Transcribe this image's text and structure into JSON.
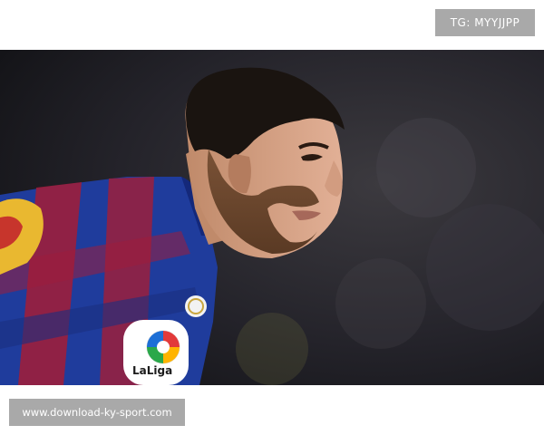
{
  "watermark_top": {
    "text": "TG: MYYJJPP"
  },
  "photo": {
    "subject": "football player in profile, blue and red striped kit",
    "badges": [
      "laliga-logo",
      "league-patch"
    ]
  },
  "patch": {
    "text": "LaLiga"
  },
  "watermark_bottom": {
    "text": "www.download-ky-sport.com"
  },
  "colors": {
    "kit_blue": "#1f3c9c",
    "kit_red": "#9c1e3c",
    "badge_gray": "#a9a9a9",
    "background": "#ffffff"
  }
}
